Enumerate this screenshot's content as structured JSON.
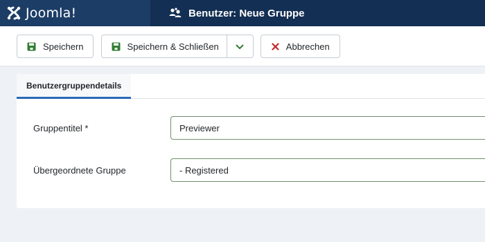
{
  "brand": {
    "name": "Joomla!"
  },
  "header": {
    "title": "Benutzer: Neue Gruppe",
    "title_icon": "users-icon"
  },
  "toolbar": {
    "save_label": "Speichern",
    "save_close_label": "Speichern & Schließen",
    "cancel_label": "Abbrechen"
  },
  "tabs": [
    {
      "label": "Benutzergruppendetails",
      "active": true
    }
  ],
  "form": {
    "title_label": "Gruppentitel *",
    "title_value": "Previewer",
    "parent_label": "Übergeordnete Gruppe",
    "parent_value": "- Registered"
  },
  "colors": {
    "header_bg": "#132f53",
    "brand_bg": "#1c3d66",
    "save_icon": "#2f7d32",
    "cancel_icon": "#c52828",
    "tab_accent": "#2a69b8",
    "field_border": "#6f8e6c"
  }
}
